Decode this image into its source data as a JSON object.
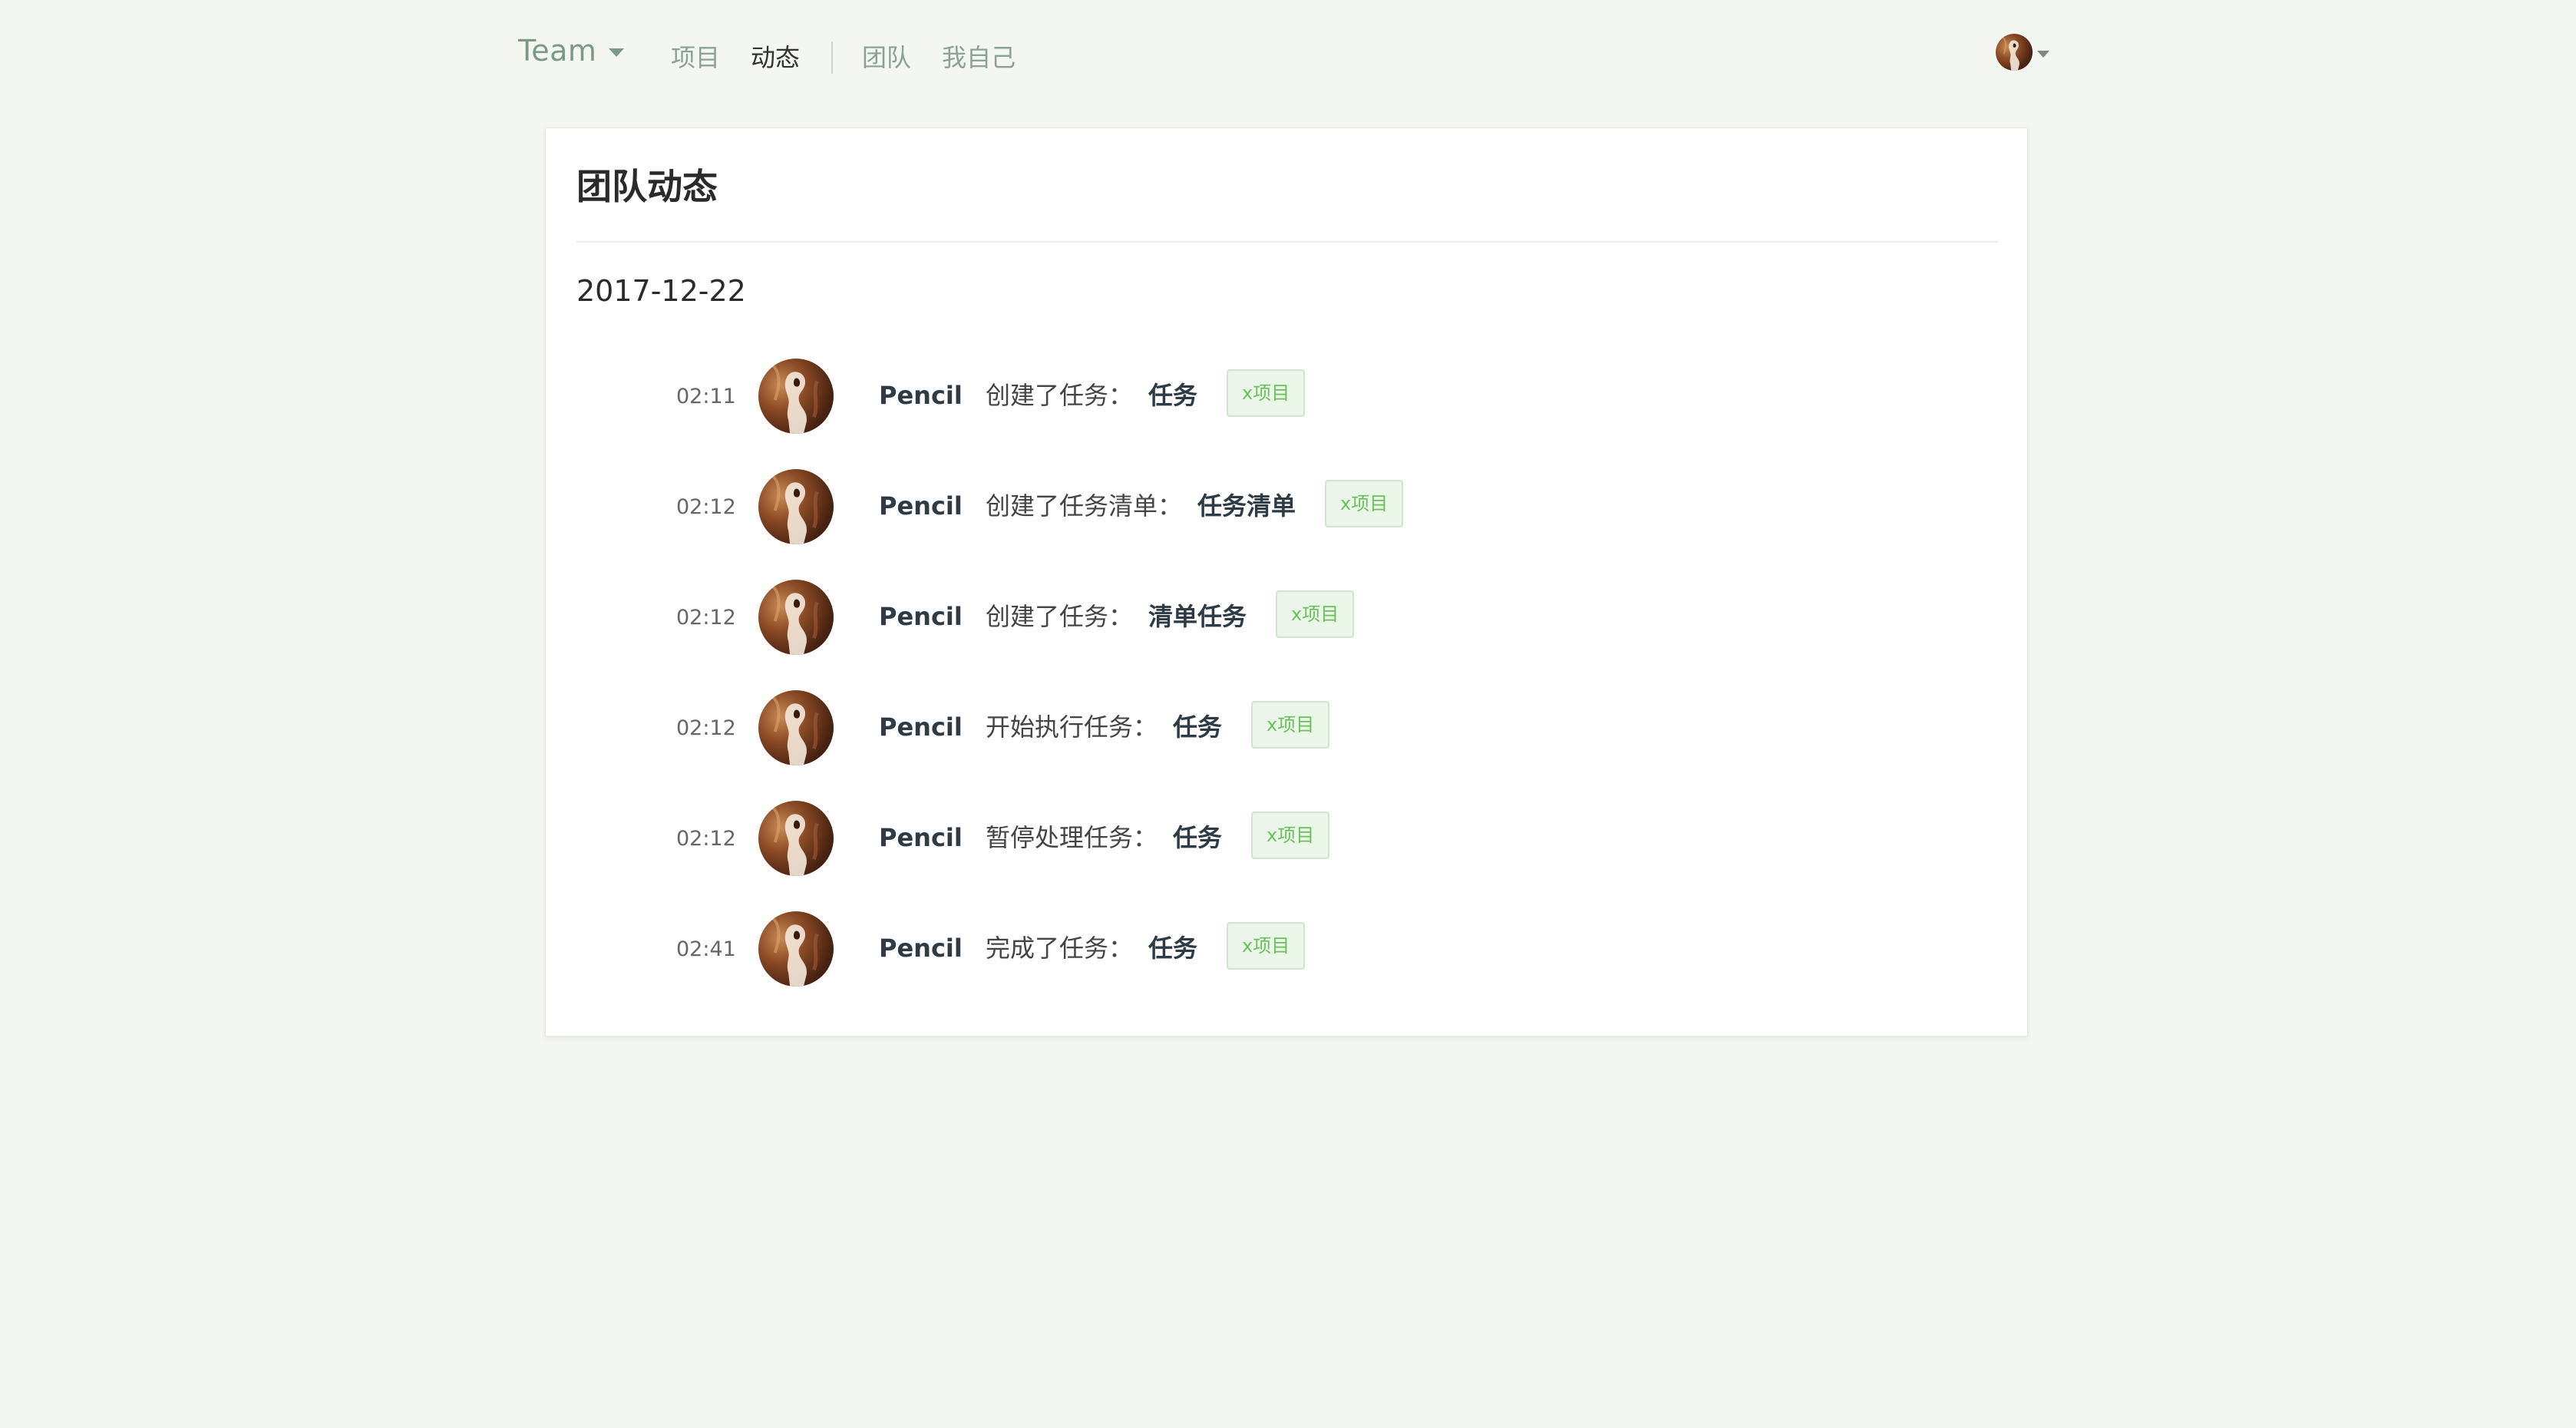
{
  "nav": {
    "team_name": "Team",
    "links": [
      "项目",
      "动态",
      "团队",
      "我自己"
    ],
    "active": "动态"
  },
  "card": {
    "title": "团队动态",
    "date": "2017-12-22"
  },
  "activities": [
    {
      "time": "02:11",
      "user": "Pencil",
      "action": "创建了任务：",
      "target": "任务",
      "project": "x项目"
    },
    {
      "time": "02:12",
      "user": "Pencil",
      "action": "创建了任务清单：",
      "target": "任务清单",
      "project": "x项目"
    },
    {
      "time": "02:12",
      "user": "Pencil",
      "action": "创建了任务：",
      "target": "清单任务",
      "project": "x项目"
    },
    {
      "time": "02:12",
      "user": "Pencil",
      "action": "开始执行任务：",
      "target": "任务",
      "project": "x项目"
    },
    {
      "time": "02:12",
      "user": "Pencil",
      "action": "暂停处理任务：",
      "target": "任务",
      "project": "x项目"
    },
    {
      "time": "02:41",
      "user": "Pencil",
      "action": "完成了任务：",
      "target": "任务",
      "project": "x项目"
    }
  ],
  "colors": {
    "page_background": "#f3f6f1",
    "nav_link": "#8aa394",
    "tag_text": "#6bbf5d",
    "tag_background": "#eaf6e7"
  },
  "icons": {
    "team_caret": "caret-down-icon",
    "user_caret": "caret-down-icon"
  }
}
